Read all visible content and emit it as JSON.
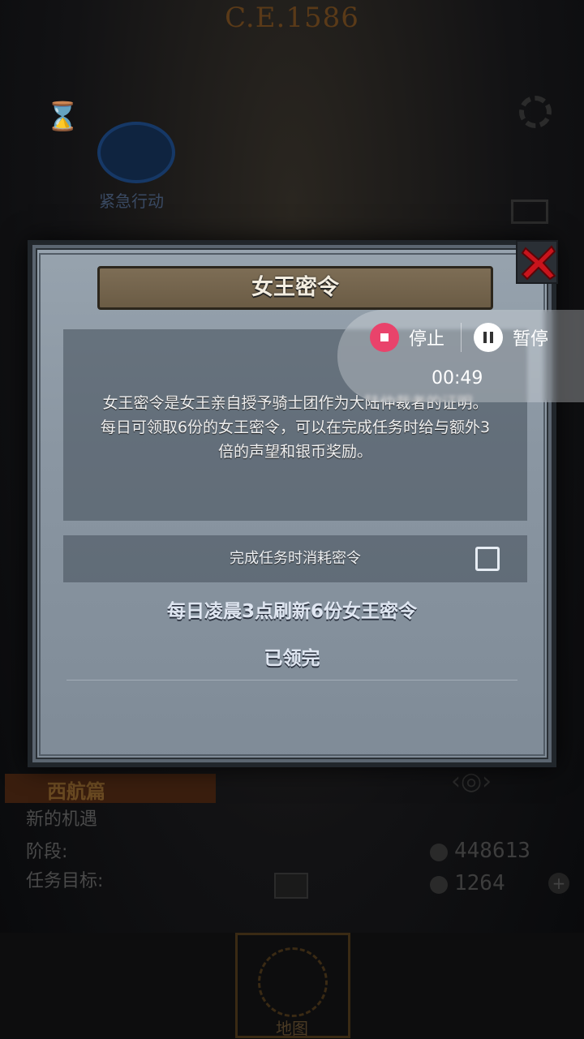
{
  "background": {
    "year": "C.E.1586",
    "emblem_caption": "紧急行动",
    "task_title": "西航篇",
    "task_lines": [
      "新的机遇",
      "阶段:",
      "任务目标:"
    ],
    "stats": [
      "448613",
      "1264"
    ],
    "nav_map_label": "地图"
  },
  "dialog": {
    "title": "女王密令",
    "description": "女王密令是女王亲自授予骑士团作为大陆仲裁者的证明。每日可领取6份的女王密令，可以在完成任务时给与额外3倍的声望和银币奖励。",
    "option_label": "完成任务时消耗密令",
    "option_checked": false,
    "refresh_text": "每日凌晨3点刷新6份女王密令",
    "claimed_text": "已领完"
  },
  "recorder": {
    "stop_label": "停止",
    "pause_label": "暂停",
    "elapsed": "00:49",
    "stop_color": "#e9436b"
  }
}
